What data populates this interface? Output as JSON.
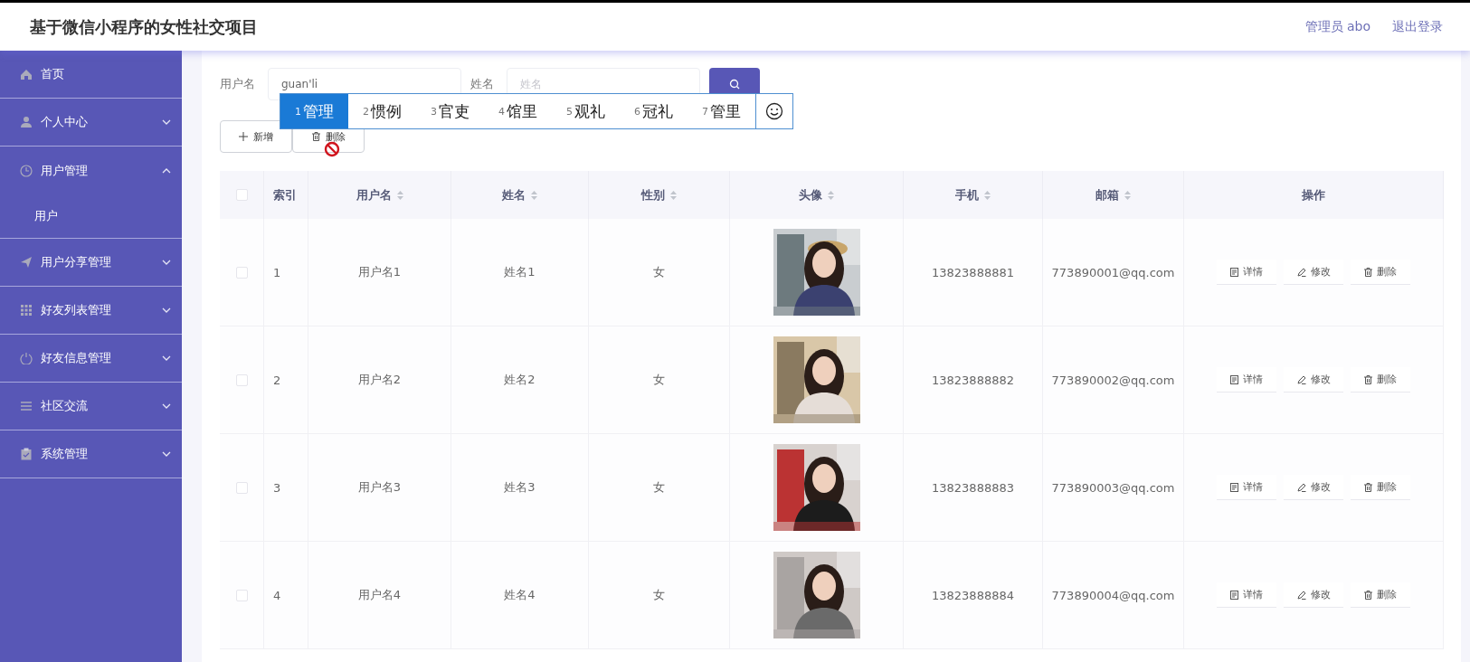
{
  "header": {
    "title": "基于微信小程序的女性社交项目",
    "user": "管理员 abo",
    "logout": "退出登录"
  },
  "sidebar": {
    "items": [
      {
        "label": "首页",
        "kind": "link"
      },
      {
        "label": "个人中心",
        "kind": "submenu",
        "expanded": false
      },
      {
        "label": "用户管理",
        "kind": "submenu",
        "expanded": true,
        "children": [
          {
            "label": "用户"
          }
        ]
      },
      {
        "label": "用户分享管理",
        "kind": "submenu",
        "expanded": false
      },
      {
        "label": "好友列表管理",
        "kind": "submenu",
        "expanded": false
      },
      {
        "label": "好友信息管理",
        "kind": "submenu",
        "expanded": false
      },
      {
        "label": "社区交流",
        "kind": "submenu",
        "expanded": false
      },
      {
        "label": "系统管理",
        "kind": "submenu",
        "expanded": false
      }
    ]
  },
  "search": {
    "fields": [
      {
        "label": "用户名",
        "value": "guan'li"
      },
      {
        "label": "姓名",
        "placeholder": "姓名"
      }
    ]
  },
  "ime": {
    "candidates": [
      {
        "number": "1",
        "text": "管理",
        "selected": true
      },
      {
        "number": "2",
        "text": "惯例",
        "selected": false
      },
      {
        "number": "3",
        "text": "官吏",
        "selected": false
      },
      {
        "number": "4",
        "text": "馆里",
        "selected": false
      },
      {
        "number": "5",
        "text": "观礼",
        "selected": false
      },
      {
        "number": "6",
        "text": "冠礼",
        "selected": false
      },
      {
        "number": "7",
        "text": "管里",
        "selected": false
      }
    ]
  },
  "toolbar": [
    {
      "kind": "add",
      "label": "新增"
    },
    {
      "kind": "delete",
      "label": "删除"
    }
  ],
  "table": {
    "all_checked": false,
    "columns": [
      {
        "label": "索引",
        "sortable": false
      },
      {
        "label": "用户名",
        "sortable": true
      },
      {
        "label": "姓名",
        "sortable": true
      },
      {
        "label": "性别",
        "sortable": true
      },
      {
        "label": "头像",
        "sortable": true
      },
      {
        "label": "手机",
        "sortable": true
      },
      {
        "label": "邮箱",
        "sortable": true
      },
      {
        "label": "操作",
        "sortable": false
      }
    ],
    "rows": [
      {
        "checked": false,
        "index": "1",
        "username": "用户名1",
        "name": "姓名1",
        "gender": "女",
        "avatar": {
          "kind": "picture"
        },
        "phone": "13823888881",
        "email": "773890001@qq.com",
        "actions": [
          "详情",
          "修改",
          "删除"
        ]
      },
      {
        "checked": false,
        "index": "2",
        "username": "用户名2",
        "name": "姓名2",
        "gender": "女",
        "avatar": {
          "kind": "picture"
        },
        "phone": "13823888882",
        "email": "773890002@qq.com",
        "actions": [
          "详情",
          "修改",
          "删除"
        ]
      },
      {
        "checked": false,
        "index": "3",
        "username": "用户名3",
        "name": "姓名3",
        "gender": "女",
        "avatar": {
          "kind": "picture"
        },
        "phone": "13823888883",
        "email": "773890003@qq.com",
        "actions": [
          "详情",
          "修改",
          "删除"
        ]
      },
      {
        "checked": false,
        "index": "4",
        "username": "用户名4",
        "name": "姓名4",
        "gender": "女",
        "avatar": {
          "kind": "picture"
        },
        "phone": "13823888884",
        "email": "773890004@qq.com",
        "actions": [
          "详情",
          "修改",
          "删除"
        ]
      }
    ]
  }
}
